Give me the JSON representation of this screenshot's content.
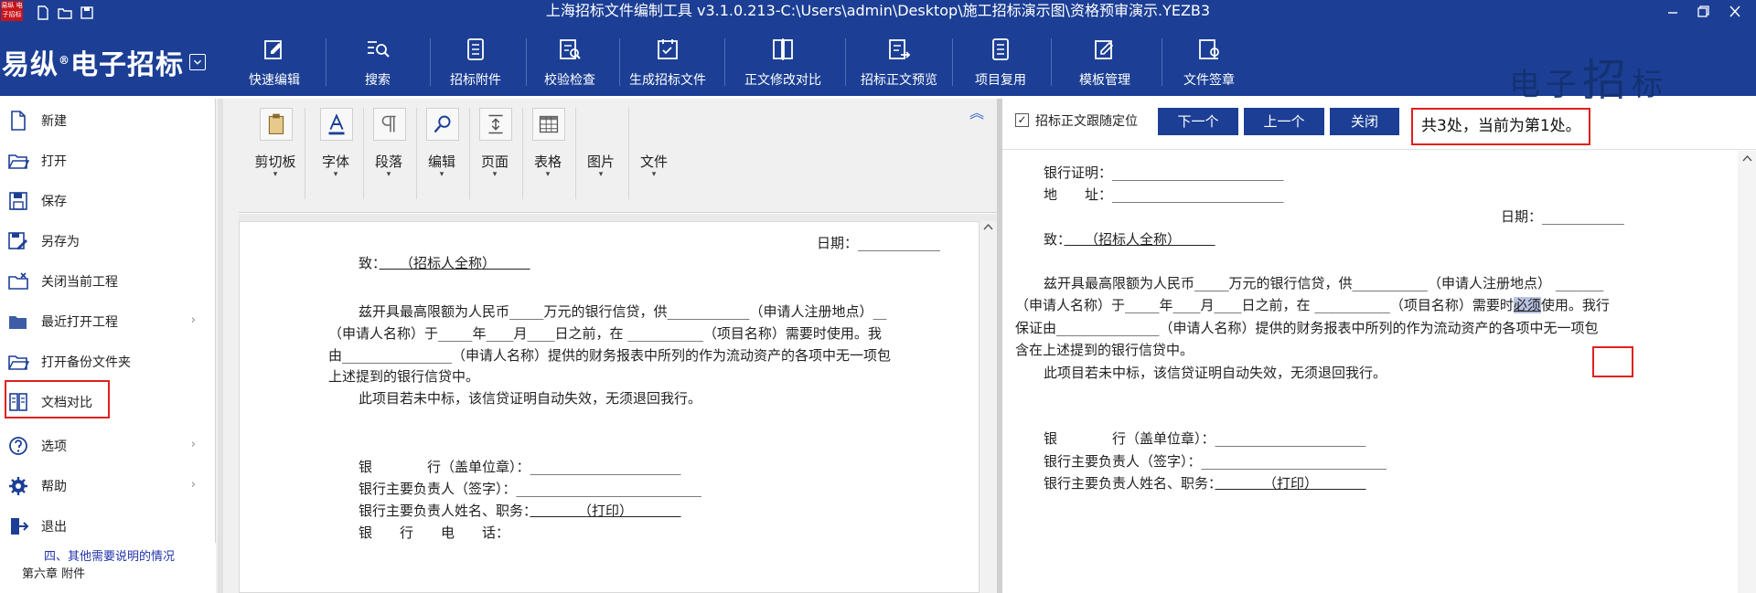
{
  "window": {
    "title": "上海招标文件编制工具 v3.1.0.213-C:\\Users\\admin\\Desktop\\施工招标演示图\\资格预审演示.YEZB3",
    "logo_text": "易纵 电子招标",
    "controls": [
      "minimize",
      "restore",
      "close"
    ]
  },
  "ribbon": {
    "brand": "易纵",
    "brand_reg": "®",
    "brand_tail": "电子招标",
    "watermark_small": "电子",
    "watermark_big": "招",
    "watermark_tail": "标",
    "tools": [
      {
        "label": "快速编辑",
        "icon": "quick-edit-icon"
      },
      {
        "label": "搜索",
        "icon": "search-icon"
      },
      {
        "label": "招标附件",
        "icon": "attachment-icon"
      },
      {
        "label": "校验检查",
        "icon": "check-icon"
      },
      {
        "label": "生成招标文件",
        "icon": "generate-doc-icon"
      },
      {
        "label": "正文修改对比",
        "icon": "compare-icon"
      },
      {
        "label": "招标正文预览",
        "icon": "preview-icon"
      },
      {
        "label": "项目复用",
        "icon": "reuse-icon"
      },
      {
        "label": "模板管理",
        "icon": "template-icon"
      },
      {
        "label": "文件签章",
        "icon": "sign-icon"
      }
    ]
  },
  "file_menu": {
    "items": [
      {
        "label": "新建",
        "icon": "new-file-icon",
        "submenu": false
      },
      {
        "label": "打开",
        "icon": "open-folder-icon",
        "submenu": false
      },
      {
        "label": "保存",
        "icon": "save-icon",
        "submenu": false
      },
      {
        "label": "另存为",
        "icon": "save-as-icon",
        "submenu": false
      },
      {
        "label": "关闭当前工程",
        "icon": "close-project-icon",
        "submenu": false
      },
      {
        "label": "最近打开工程",
        "icon": "recent-folder-icon",
        "submenu": true
      },
      {
        "label": "打开备份文件夹",
        "icon": "backup-folder-icon",
        "submenu": false
      },
      {
        "label": "文档对比",
        "icon": "compare-docs-icon",
        "submenu": false
      },
      {
        "label": "选项",
        "icon": "help-circle-icon",
        "submenu": true
      },
      {
        "label": "帮助",
        "icon": "gear-icon",
        "submenu": true
      },
      {
        "label": "退出",
        "icon": "exit-icon",
        "submenu": false
      }
    ],
    "submenu_glyph": "›"
  },
  "outline": {
    "item_1": "四、其他需要说明的情况",
    "item_2": "第六章 附件"
  },
  "editor_toolbar": {
    "groups": [
      {
        "label": "剪切板",
        "icon": "clipboard-icon"
      },
      {
        "label": "字体",
        "icon": "font-icon"
      },
      {
        "label": "段落",
        "icon": "paragraph-icon"
      },
      {
        "label": "编辑",
        "icon": "find-icon"
      },
      {
        "label": "页面",
        "icon": "page-icon"
      },
      {
        "label": "表格",
        "icon": "table-icon"
      },
      {
        "label": "图片",
        "icon": "picture-icon"
      },
      {
        "label": "文件",
        "icon": "file-icon"
      }
    ],
    "dropdown_glyph": "▾",
    "collapse_glyph": "︽"
  },
  "left_doc": {
    "date_label": "日期：",
    "to_label": "致：",
    "to_value": "（招标人全称）",
    "p1_a": "兹开具最高限额为人民币",
    "p1_b": "万元的银行信贷，供",
    "p1_c": "（申请人注册地点）",
    "p2_a": "（申请人名称）于",
    "p2_year": "年",
    "p2_month": "月",
    "p2_day": "日之前，在",
    "p2_b": "（项目名称）需要时使用。我",
    "p3_a": "由",
    "p3_b": "（申请人名称）提供的财务报表中所列的作为流动资产的各项中无一项包",
    "p4": "上述提到的银行信贷中。",
    "p5": "此项目若未中标，该信贷证明自动失效，无须退回我行。",
    "bank_label": "银　　　　行（盖单位章）：",
    "head_label": "银行主要负责人（签字）：",
    "head_name_label": "银行主要负责人姓名、职务：",
    "print_value": "（打印）",
    "phone_label": "银　　行　　电　　话："
  },
  "right_panel": {
    "follow_checked": "✓",
    "follow_label": "招标正文跟随定位",
    "next_button": "下一个",
    "prev_button": "上一个",
    "close_button": "关闭",
    "match_status": "共3处，当前为第1处。"
  },
  "right_doc": {
    "bank_cert_label": "银行证明：",
    "address_label": "地　　址：",
    "date_label": "日期：",
    "to_label": "致：",
    "to_value": "（招标人全称）",
    "p1_a": "兹开具最高限额为人民币",
    "p1_b": "万元的银行信贷，供",
    "p1_c": "（申请人注册地点）",
    "p2_a": "（申请人名称）于",
    "p2_year": "年",
    "p2_month": "月",
    "p2_day": "日之前，在",
    "p2_b": "（项目名称）需要时",
    "highlight": "必须",
    "p2_c": "使用。我行",
    "p3_a": "保证由",
    "p3_b": "（申请人名称）提供的财务报表中所列的作为流动资产的各项中无一项包",
    "p4": "含在上述提到的银行信贷中。",
    "p5": "此项目若未中标，该信贷证明自动失效，无须退回我行。",
    "bank_label": "银　　　　行（盖单位章）：",
    "head_label": "银行主要负责人（签字）：",
    "head_name_label": "银行主要负责人姓名、职务：",
    "print_value": "（打印）"
  },
  "colors": {
    "titlebar": "#1c3f95",
    "highlight_border": "#e02020",
    "button": "#1c3f95"
  }
}
